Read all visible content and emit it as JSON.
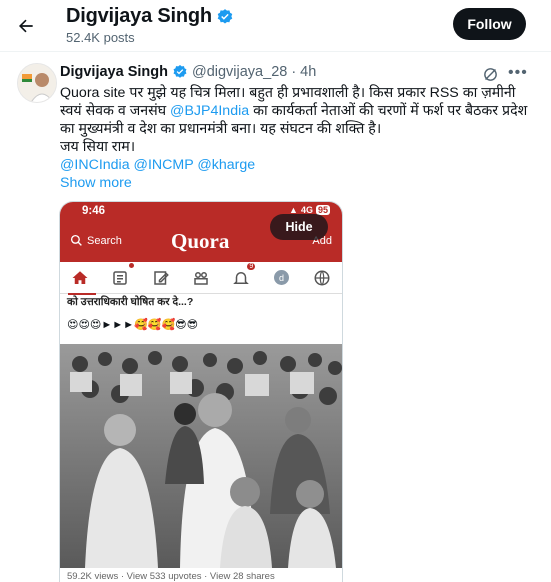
{
  "header": {
    "back_icon": "arrow-left-icon",
    "name": "Digvijaya Singh",
    "posts_count": "52.4K posts",
    "follow_label": "Follow"
  },
  "tweet": {
    "display_name": "Digvijaya Singh",
    "handle": "@digvijaya_28",
    "separator": "·",
    "time": "4h",
    "text_part1": "Quora site पर मुझे यह चित्र मिला। बहुत ही प्रभावशाली है। किस प्रकार RSS का ज़मीनी स्वयं सेवक व जनसंघ ",
    "text_mention": "@BJP4India",
    "text_part2": " का कार्यकर्ता नेताओं की चरणों में फर्श पर बैठकर प्रदेश का मुख्यमंत्री व देश का प्रधानमंत्री बना। यह संघटन की शक्ति है।",
    "text_line2": "जय सिया राम।",
    "mentions": "@INCIndia @INCMP @kharge",
    "show_more": "Show more",
    "more_icon": "more-dots-icon",
    "grok_icon": "grok-icon"
  },
  "media": {
    "status_time": "9:46",
    "status_network": "4G",
    "status_battery": "95",
    "search_label": "Search",
    "logo": "Quora",
    "add_label": "Add",
    "hide_label": "Hide",
    "notification_count": "9",
    "profile_initial": "d",
    "question_text": "को उत्तराधिकारी घोषित कर दे...?",
    "emojis": "😍😍😍►►►🥰🥰🥰😎😎",
    "footer": "59.2K views · View 533 upvotes · View 28 shares"
  },
  "colors": {
    "accent": "#1d9bf0",
    "quora_red": "#b92b27",
    "verified": "#1d9bf0"
  }
}
